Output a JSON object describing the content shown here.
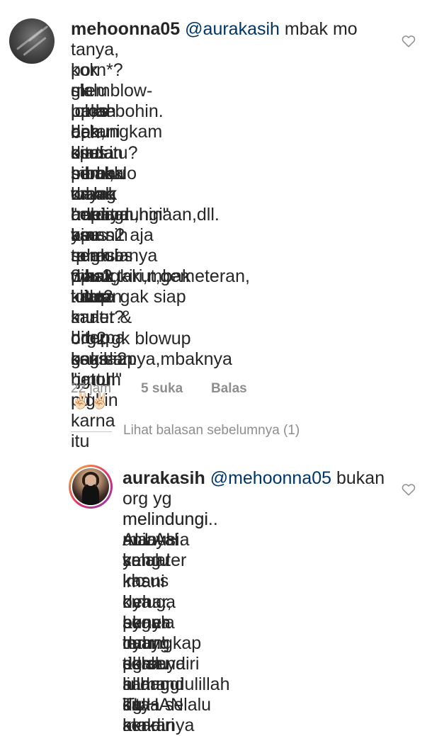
{
  "comment1": {
    "username": "mehoonna05",
    "mention": "@aurakasih",
    "text_first": " mbak mo",
    "lines": [
      "tanya, kok slalu lolos dr ksus berbau",
      "porn*? gk prnah berani smua pihak",
      "memblow-up,hebohin. di bungkam",
      "pake apa, biar semua orang hening",
      "bak ditelan bumi,klo mbak ada ksus",
      "sprti itu? semua kayak \"melindungi\"",
      "mbak. wah hebat ya udah 3 x lolos",
      "dr cercaan,hinaan,dll. aman2 aja",
      "hdpnya. apa sih rahasianya mbak",
      "biar semua pihak tutup mulut?",
      "tp gk bs dpungkiri,mbak kliatan",
      "was2,takut,gemeteran, karna gak siap",
      "kalo2 karier & hdup bakalan runtuh pd",
      "saat diterpa ksus bgtu. mgkin karna itu",
      "org2 gk blowup segila2nya,mbaknya"
    ],
    "last_line": "gak siap \"jatoh\"",
    "emoji": "✌🏻✌🏻",
    "time": "22 jam",
    "likes": "5 suka",
    "reply": "Balas"
  },
  "view_previous_replies": "Lihat balasan sebelumnya (1)",
  "comment2": {
    "username": "aurakasih",
    "mention": "@mehoonna05",
    "text_first": " bukan",
    "lines": [
      "org yg melindungi.. ALLAH selalu",
      "melindungi manusia yang ter",
      "aniaya.. kan kasus nya ga bener",
      "smua! klo kmu punya iman! di",
      "imani deh... segala hal yg tidak",
      "benar, akan terungkap dg sendiri",
      "nya dan akan hilang dg sendiri",
      "nya.. percaya sama TUHAN akan",
      "selalu lindungi kita. makanya",
      "allhamdulillah saya selalu kena"
    ]
  },
  "icons": {
    "like1": "heart-outline-icon",
    "like2": "heart-outline-icon"
  },
  "colors": {
    "text": "#262626",
    "muted": "#8e8e8e",
    "mention": "#003569",
    "divider": "#c7c7c7"
  }
}
